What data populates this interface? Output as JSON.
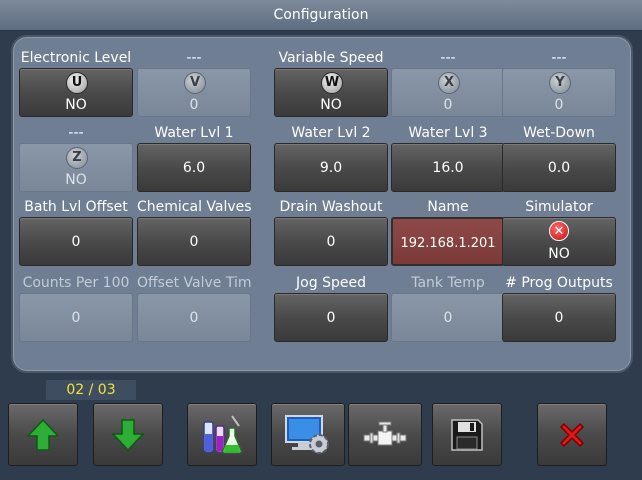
{
  "window": {
    "title": "Configuration"
  },
  "rows": [
    [
      {
        "label": "Electronic Level",
        "value": "NO",
        "icon": "U",
        "enabled": true,
        "label_dim": false
      },
      {
        "label": "---",
        "value": "0",
        "icon": "V",
        "enabled": false,
        "label_dim": false
      },
      {
        "label": "Variable Speed",
        "value": "NO",
        "icon": "W",
        "enabled": true,
        "label_dim": false
      },
      {
        "label": "---",
        "value": "0",
        "icon": "X",
        "enabled": false,
        "label_dim": false
      },
      {
        "label": "---",
        "value": "0",
        "icon": "Y",
        "enabled": false,
        "label_dim": false
      }
    ],
    [
      {
        "label": "---",
        "value": "NO",
        "icon": "Z",
        "enabled": false,
        "label_dim": false
      },
      {
        "label": "Water Lvl 1",
        "value": "6.0",
        "enabled": true,
        "label_dim": false
      },
      {
        "label": "Water Lvl 2",
        "value": "9.0",
        "enabled": true,
        "label_dim": false
      },
      {
        "label": "Water Lvl 3",
        "value": "16.0",
        "enabled": true,
        "label_dim": false
      },
      {
        "label": "Wet-Down",
        "value": "0.0",
        "enabled": true,
        "label_dim": false
      }
    ],
    [
      {
        "label": "Bath Lvl Offset",
        "value": "0",
        "enabled": true,
        "label_dim": false
      },
      {
        "label": "Chemical Valves",
        "value": "0",
        "enabled": true,
        "label_dim": false
      },
      {
        "label": "Drain Washout",
        "value": "0",
        "enabled": true,
        "label_dim": false
      },
      {
        "label": "Name",
        "value": "192.168.1.201",
        "enabled": true,
        "highlight": true,
        "label_dim": false
      },
      {
        "label": "Simulator",
        "value": "NO",
        "icon": "x-circle",
        "enabled": true,
        "label_dim": false
      }
    ],
    [
      {
        "label": "Counts Per 100",
        "value": "0",
        "enabled": false,
        "label_dim": true
      },
      {
        "label": "Offset Valve Time",
        "value": "0",
        "enabled": false,
        "label_dim": true
      },
      {
        "label": "Jog Speed",
        "value": "0",
        "enabled": true,
        "label_dim": false
      },
      {
        "label": "Tank Temp",
        "value": "0",
        "enabled": false,
        "label_dim": true
      },
      {
        "label": "# Prog Outputs",
        "value": "0",
        "enabled": true,
        "label_dim": false
      }
    ]
  ],
  "pager": {
    "text": "02 / 03"
  },
  "toolbar": [
    {
      "name": "page-up-button",
      "icon": "green-arrow-up-icon"
    },
    {
      "name": "page-down-button",
      "icon": "green-arrow-down-icon"
    },
    {
      "name": "chemicals-button",
      "icon": "lab-flasks-icon"
    },
    {
      "name": "system-settings-button",
      "icon": "monitor-gear-icon"
    },
    {
      "name": "valve-button",
      "icon": "valve-icon"
    },
    {
      "name": "save-button",
      "icon": "floppy-disk-icon"
    },
    {
      "name": "close-button",
      "icon": "red-x-icon"
    }
  ],
  "colors": {
    "background": "#2f3c4d",
    "panel": "#6f7e92",
    "pager_text": "#f2e23a",
    "highlight_button": "#8f4a48"
  }
}
